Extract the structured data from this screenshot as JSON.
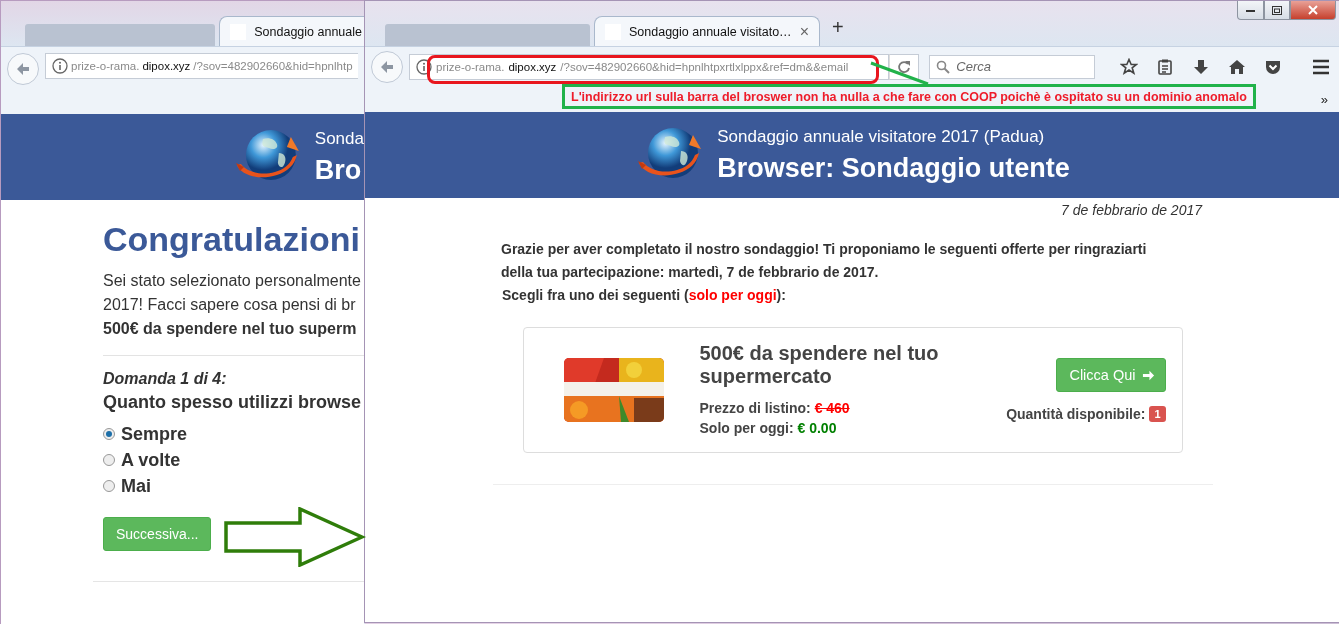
{
  "back_window": {
    "tab_title": "Sondaggio annuale",
    "address": {
      "prefix": "prize-o-rama.",
      "domain": "dipox.xyz",
      "path": "/?sov=482902660&hid=hpnlhtp"
    },
    "header": {
      "subtitle": "Sonda",
      "title": "Bro"
    },
    "heading": "Congratulazioni",
    "intro_lines": [
      "Sei stato selezionato personalmente",
      "2017! Facci sapere cosa pensi di br"
    ],
    "prize_line": "500€ da spendere nel tuo superm",
    "question_number": "Domanda 1 di 4:",
    "question": "Quanto spesso utilizzi browse",
    "options": [
      {
        "label": "Sempre",
        "selected": true
      },
      {
        "label": "A volte",
        "selected": false
      },
      {
        "label": "Mai",
        "selected": false
      }
    ],
    "next_button": "Successiva..."
  },
  "front_window": {
    "tab_title": "Sondaggio annuale visitato…",
    "tab_close": "×",
    "new_tab": "+",
    "address": {
      "prefix": "prize-o-rama.",
      "domain": "dipox.xyz",
      "path": "/?sov=482902660&hid=hpnlhtpxrtlxlppx&ref=dm&&email"
    },
    "search": {
      "placeholder": "Cerca"
    },
    "bookmarks_overflow": "»",
    "header": {
      "subtitle": "Sondaggio annuale visitatore 2017 (Padua)",
      "title": "Browser: Sondaggio utente"
    },
    "date": "7 de febbrario de 2017",
    "intro": "Grazie per aver completato il nostro sondaggio! Ti proponiamo le seguenti offerte per ringraziarti della tua partecipazione: martedì, 7 de febbrario de 2017.",
    "choose": {
      "before": "Scegli fra uno dei seguenti (",
      "highlight": "solo per oggi",
      "after": "):"
    },
    "offer": {
      "title": "500€ da spendere nel tuo supermercato",
      "list_price_label": "Prezzo di listino:",
      "list_price": "€ 460",
      "today_label": "Solo per oggi:",
      "today_price": "€ 0.00",
      "button": "Clicca Qui",
      "quantity_label": "Quantità disponibile:",
      "quantity": "1"
    }
  },
  "annotation": {
    "text": "L'indirizzo url sulla barra del broswer non ha nulla a che fare con COOP poichè è ospitato su un dominio anomalo"
  }
}
